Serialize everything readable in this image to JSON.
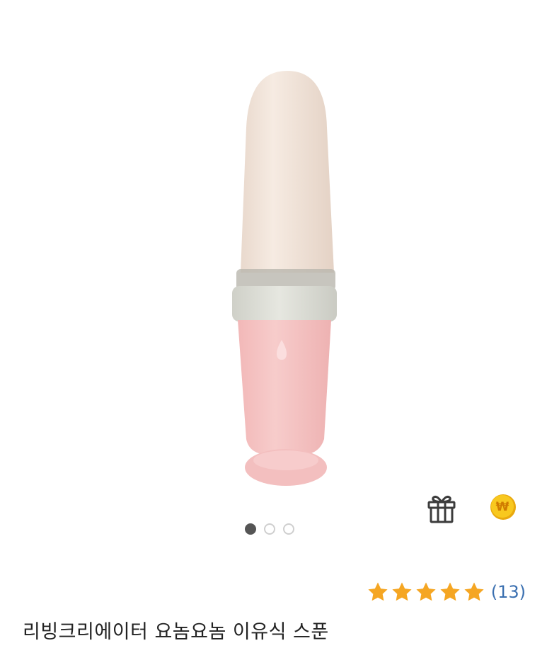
{
  "product": {
    "title": "리빙크리에이터 요놈요놈 이유식 스푼",
    "rating": 5,
    "review_count": "(13)",
    "image_index": 1,
    "image_total": 3
  },
  "icons": {
    "gift": "gift-icon",
    "coin": "won-coin-icon",
    "coin_symbol": "₩",
    "star": "star-icon"
  },
  "colors": {
    "star": "#F5A623",
    "coin": "#F7C21B",
    "spoon_head": "#F0E2D8",
    "spoon_body": "#F4C3C3",
    "collar": "#DCDDD6",
    "review_link": "#3A6FB0"
  }
}
